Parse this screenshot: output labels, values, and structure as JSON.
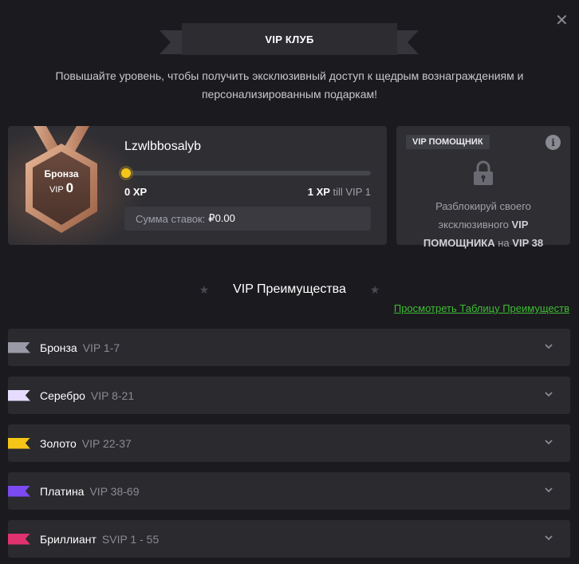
{
  "header": {
    "title": "VIP КЛУБ",
    "subtitle": "Повышайте уровень, чтобы получить эксклюзивный доступ к щедрым вознаграждениям и персонализированным подаркам!",
    "close_icon": "close-icon"
  },
  "profile": {
    "medal": {
      "rank": "Бронза",
      "vip_label": "VIP",
      "vip_level": "0",
      "color": "#b87a5a"
    },
    "username": "Lzwlbbosalyb",
    "progress_fraction": 0.0,
    "xp_current": "0 XP",
    "xp_next_amount": "1 XP",
    "xp_next_till": "till VIP 1",
    "stakes_label": "Сумма ставок:",
    "stakes_value": "₽0.00"
  },
  "helper": {
    "tag": "VIP ПОМОЩНИК",
    "info_icon": "info-icon",
    "lock_icon": "lock-icon",
    "text_before": "Разблокируй своего эксклюзивного",
    "text_bold": "VIP ПОМОЩНИКА",
    "text_mid": "на",
    "text_level": "VIP 38"
  },
  "benefits": {
    "title": "VIP Преимущества",
    "link": "Просмотреть Таблицу Преимуществ",
    "link_color": "#3fbb34"
  },
  "tiers": [
    {
      "name": "Бронза",
      "range": "VIP 1-7",
      "color": "#9a9aa6"
    },
    {
      "name": "Серебро",
      "range": "VIP 8-21",
      "color": "#e6dcff"
    },
    {
      "name": "Золото",
      "range": "VIP 22-37",
      "color": "#f5c518"
    },
    {
      "name": "Платина",
      "range": "VIP 38-69",
      "color": "#7b4af0"
    },
    {
      "name": "Бриллиант",
      "range": "SVIP 1 - 55",
      "color": "#e0326e"
    }
  ]
}
